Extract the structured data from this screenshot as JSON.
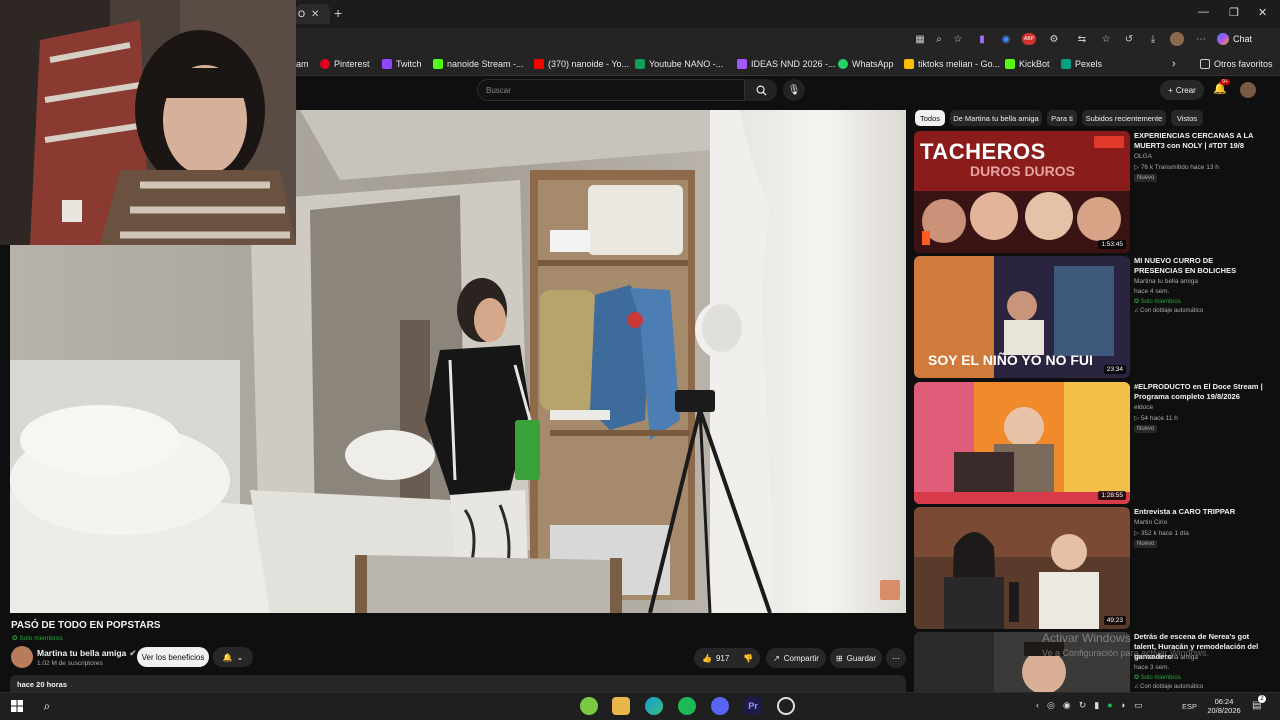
{
  "browser": {
    "tab_partial": "O",
    "chat_label": "Chat",
    "other_favorites": "Otros favoritos",
    "ext_badge": "ABP",
    "bookmarks": [
      {
        "label": "am",
        "color": "#555555"
      },
      {
        "label": "Pinterest",
        "color": "#e60023"
      },
      {
        "label": "Twitch",
        "color": "#9146ff"
      },
      {
        "label": "nanoide Stream -...",
        "color": "#53fc18"
      },
      {
        "label": "(370) nanoide - Yo...",
        "color": "#ff0000"
      },
      {
        "label": "Youtube NANO -...",
        "color": "#0f9d58"
      },
      {
        "label": "IDEAS NND 2026 -...",
        "color": "#a259ff"
      },
      {
        "label": "WhatsApp",
        "color": "#25d366"
      },
      {
        "label": "tiktoks melian - Go...",
        "color": "#fbbc04"
      },
      {
        "label": "KickBot",
        "color": "#53fc18"
      },
      {
        "label": "Pexels",
        "color": "#05a081"
      }
    ]
  },
  "header": {
    "search_placeholder": "Buscar",
    "create_label": "Crear",
    "notif_count": "9+"
  },
  "video": {
    "title": "PASÓ DE TODO EN POPSTARS",
    "members_only": "Solo miembros",
    "channel": "Martina tu bella amiga",
    "subscribers": "1.02 M de suscriptores",
    "benefits_button": "Ver los beneficios",
    "likes": "917",
    "share_label": "Compartir",
    "save_label": "Guardar",
    "time_ago": "hace 20 horas"
  },
  "chips": [
    "Todos",
    "De Martina tu bella amiga",
    "Para ti",
    "Subidos recientemente",
    "Vistos"
  ],
  "recommendations": [
    {
      "title": "EXPERIENCIAS CERCANAS A LA MUERT3 con NOLY | #TDT 19/8",
      "channel": "OLGA",
      "views": "76 k  Transmitido hace 13 h",
      "badge": "Nuevo",
      "duration": "1:53:45",
      "thumb_text": "TACHEROS",
      "thumb_text2": "DUROS DUROS"
    },
    {
      "title": "MI NUEVO CURRO DE PRESENCIAS EN BOLICHES",
      "channel": "Martina tu bella amiga",
      "views": "hace 4 sem.",
      "member": "Solo miembros",
      "dub": "Con doblaje automático",
      "duration": "23:34",
      "thumb_text": "SOY EL NIÑO YO NO FUI"
    },
    {
      "title": "#ELPRODUCTO en El Doce Stream | Programa completo 19/8/2026",
      "channel": "eldoce",
      "views": "54  hace 11 h",
      "badge": "Nuevo",
      "duration": "1:28:55"
    },
    {
      "title": "Entrevista a CARO TRIPPAR",
      "channel": "Martin Cirio",
      "views": "352 k  hace 1 día",
      "badge": "Nuevo",
      "duration": "49:23"
    },
    {
      "title": "Detrás de escena de Nerea's got talent, Huracán y remodelación del ganxadero",
      "channel": "Martina tu bella amiga",
      "views": "hace 3 sem.",
      "member": "Solo miembros",
      "dub": "Con doblaje automático"
    }
  ],
  "windows_watermark": {
    "line1": "Activar Windows",
    "line2": "Ve a Configuración para activar Windows."
  },
  "taskbar": {
    "lang": "ESP",
    "time": "06:24",
    "date": "20/8/2026",
    "notif": "2"
  }
}
